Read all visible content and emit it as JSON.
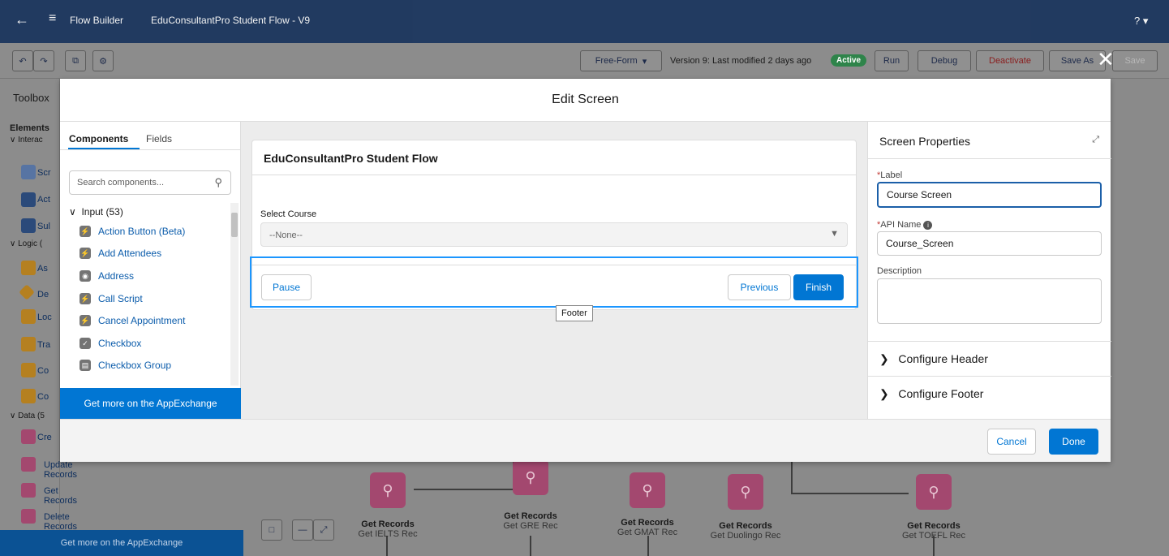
{
  "topbar": {
    "app_label": "Flow Builder",
    "flow_name": "EduConsultantPro Student Flow - V9",
    "help_label": "? ▾"
  },
  "toolbar": {
    "layout_mode": "Free-Form",
    "version_text": "Version 9: Last modified 2 days ago",
    "status_badge": "Active",
    "run": "Run",
    "debug": "Debug",
    "deactivate": "Deactivate",
    "save_as": "Save As",
    "save": "Save"
  },
  "toolbox": {
    "title": "Toolbox",
    "elements_tab": "Elements",
    "groups": [
      "Interac",
      "Logic (",
      "Data (5"
    ],
    "items_partial": [
      "Scr",
      "Act",
      "Sul",
      "As",
      "De",
      "Loc",
      "Tra",
      "Co",
      "Co",
      "Cre"
    ],
    "items_full": [
      "Update Records",
      "Get Records",
      "Delete Records"
    ],
    "appexchange": "Get more on the AppExchange"
  },
  "canvas_nodes": [
    {
      "type": "Get Records",
      "name": "Get IELTS Rec"
    },
    {
      "type": "Get Records",
      "name": "Get GRE Rec"
    },
    {
      "type": "Get Records",
      "name": "Get GMAT Rec"
    },
    {
      "type": "Get Records",
      "name": "Get Duolingo Rec"
    },
    {
      "type": "Get Records",
      "name": "Get TOEFL Rec"
    }
  ],
  "modal": {
    "title": "Edit Screen",
    "cancel": "Cancel",
    "done": "Done"
  },
  "components": {
    "tab_components": "Components",
    "tab_fields": "Fields",
    "search_placeholder": "Search components...",
    "group_label": "Input (53)",
    "items": [
      "Action Button (Beta)",
      "Add Attendees",
      "Address",
      "Call Script",
      "Cancel Appointment",
      "Checkbox",
      "Checkbox Group"
    ],
    "appexchange": "Get more on the AppExchange"
  },
  "screen_preview": {
    "header_title": "EduConsultantPro Student Flow",
    "field_label": "Select Course",
    "field_value": "--None--",
    "pause": "Pause",
    "previous": "Previous",
    "finish": "Finish",
    "footer_tooltip": "Footer"
  },
  "properties": {
    "title": "Screen Properties",
    "label_label": "Label",
    "label_value": "Course Screen",
    "api_label": "API Name",
    "api_value": "Course_Screen",
    "description_label": "Description",
    "description_value": "",
    "configure_header": "Configure Header",
    "configure_footer": "Configure Footer"
  },
  "colors": {
    "brand": "#0176d3",
    "nav": "#16325c",
    "active_badge": "#2e844a",
    "record_node": "#a3486f"
  }
}
